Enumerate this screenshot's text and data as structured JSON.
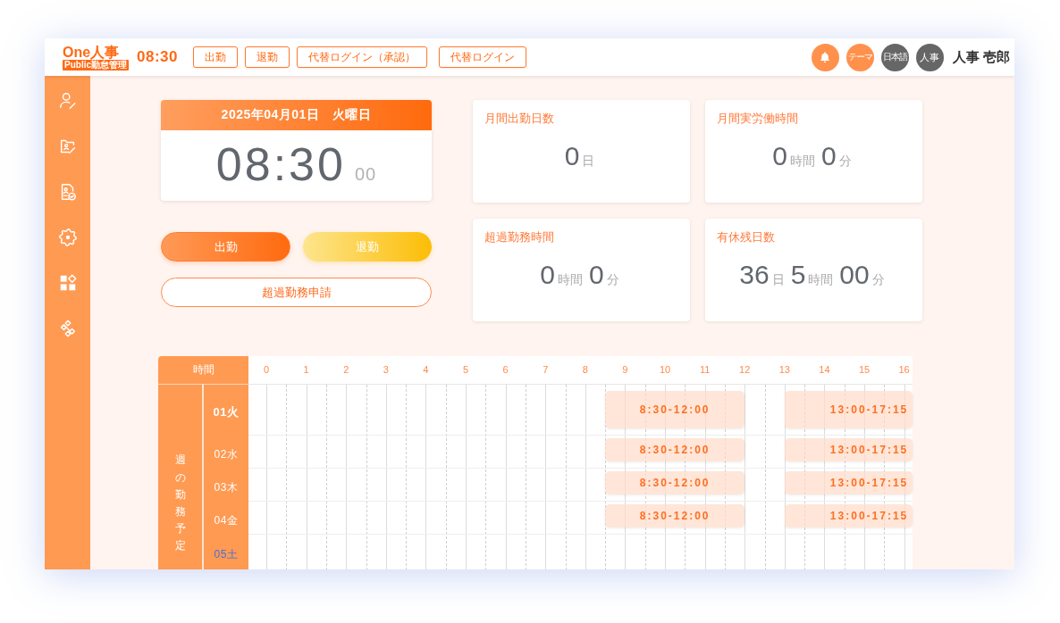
{
  "header": {
    "logo": {
      "title": "One人事",
      "subtitle": "Public勤怠管理"
    },
    "time": "08:30",
    "nav_buttons": [
      "出勤",
      "退勤",
      "代替ログイン（承認）",
      "代替ログイン"
    ],
    "actions": [
      {
        "kind": "notifications",
        "color": "#ff914d"
      },
      {
        "kind": "theme",
        "label": "テーマ",
        "color": "#ff914d"
      },
      {
        "kind": "language",
        "label": "日本語",
        "color": "#666666"
      },
      {
        "kind": "avatar",
        "label": "人事",
        "color": "#666666"
      }
    ],
    "user_name": "人事 壱郎"
  },
  "clock": {
    "date": "2025年04月01日　火曜日",
    "time": "08:30",
    "seconds": "00"
  },
  "punch_buttons": [
    {
      "kind": "clock-in",
      "label": "出勤"
    },
    {
      "kind": "clock-out",
      "label": "退勤"
    },
    {
      "kind": "request",
      "label": "超過勤務申請"
    }
  ],
  "stats": [
    {
      "title": "月間出勤日数",
      "value": [
        {
          "kind": "number",
          "text": "0"
        },
        {
          "kind": "unit",
          "text": "日"
        }
      ]
    },
    {
      "title": "月間実労働時間",
      "value": [
        {
          "kind": "number",
          "text": "0"
        },
        {
          "kind": "unit",
          "text": "時間"
        },
        {
          "kind": "number",
          "text": "0"
        },
        {
          "kind": "unit",
          "text": "分"
        }
      ]
    },
    {
      "title": "超過勤務時間",
      "value": [
        {
          "kind": "number",
          "text": "0"
        },
        {
          "kind": "unit",
          "text": "時間"
        },
        {
          "kind": "number",
          "text": "0"
        },
        {
          "kind": "unit",
          "text": "分"
        }
      ]
    },
    {
      "title": "有休残日数",
      "value": [
        {
          "kind": "number",
          "text": "36"
        },
        {
          "kind": "unit",
          "text": "日"
        },
        {
          "kind": "number",
          "text": "5"
        },
        {
          "kind": "unit",
          "text": "時間"
        },
        {
          "kind": "number",
          "text": "00"
        },
        {
          "kind": "unit",
          "text": "分"
        }
      ]
    }
  ],
  "schedule": {
    "header_label": "時間",
    "side_label": "週の勤務予定",
    "hours": [
      "0",
      "1",
      "2",
      "3",
      "4",
      "5",
      "6",
      "7",
      "8",
      "9",
      "10",
      "11",
      "12",
      "13",
      "14",
      "15",
      "16"
    ],
    "days": [
      {
        "label": "01火",
        "today": true,
        "kind": "weekday",
        "shifts": [
          "8:30-12:00",
          "13:00-17:15"
        ]
      },
      {
        "label": "02水",
        "today": false,
        "kind": "weekday",
        "shifts": [
          "8:30-12:00",
          "13:00-17:15"
        ]
      },
      {
        "label": "03木",
        "today": false,
        "kind": "weekday",
        "shifts": [
          "8:30-12:00",
          "13:00-17:15"
        ]
      },
      {
        "label": "04金",
        "today": false,
        "kind": "weekday",
        "shifts": [
          "8:30-12:00",
          "13:00-17:15"
        ]
      },
      {
        "label": "05土",
        "today": false,
        "kind": "saturday"
      }
    ]
  }
}
